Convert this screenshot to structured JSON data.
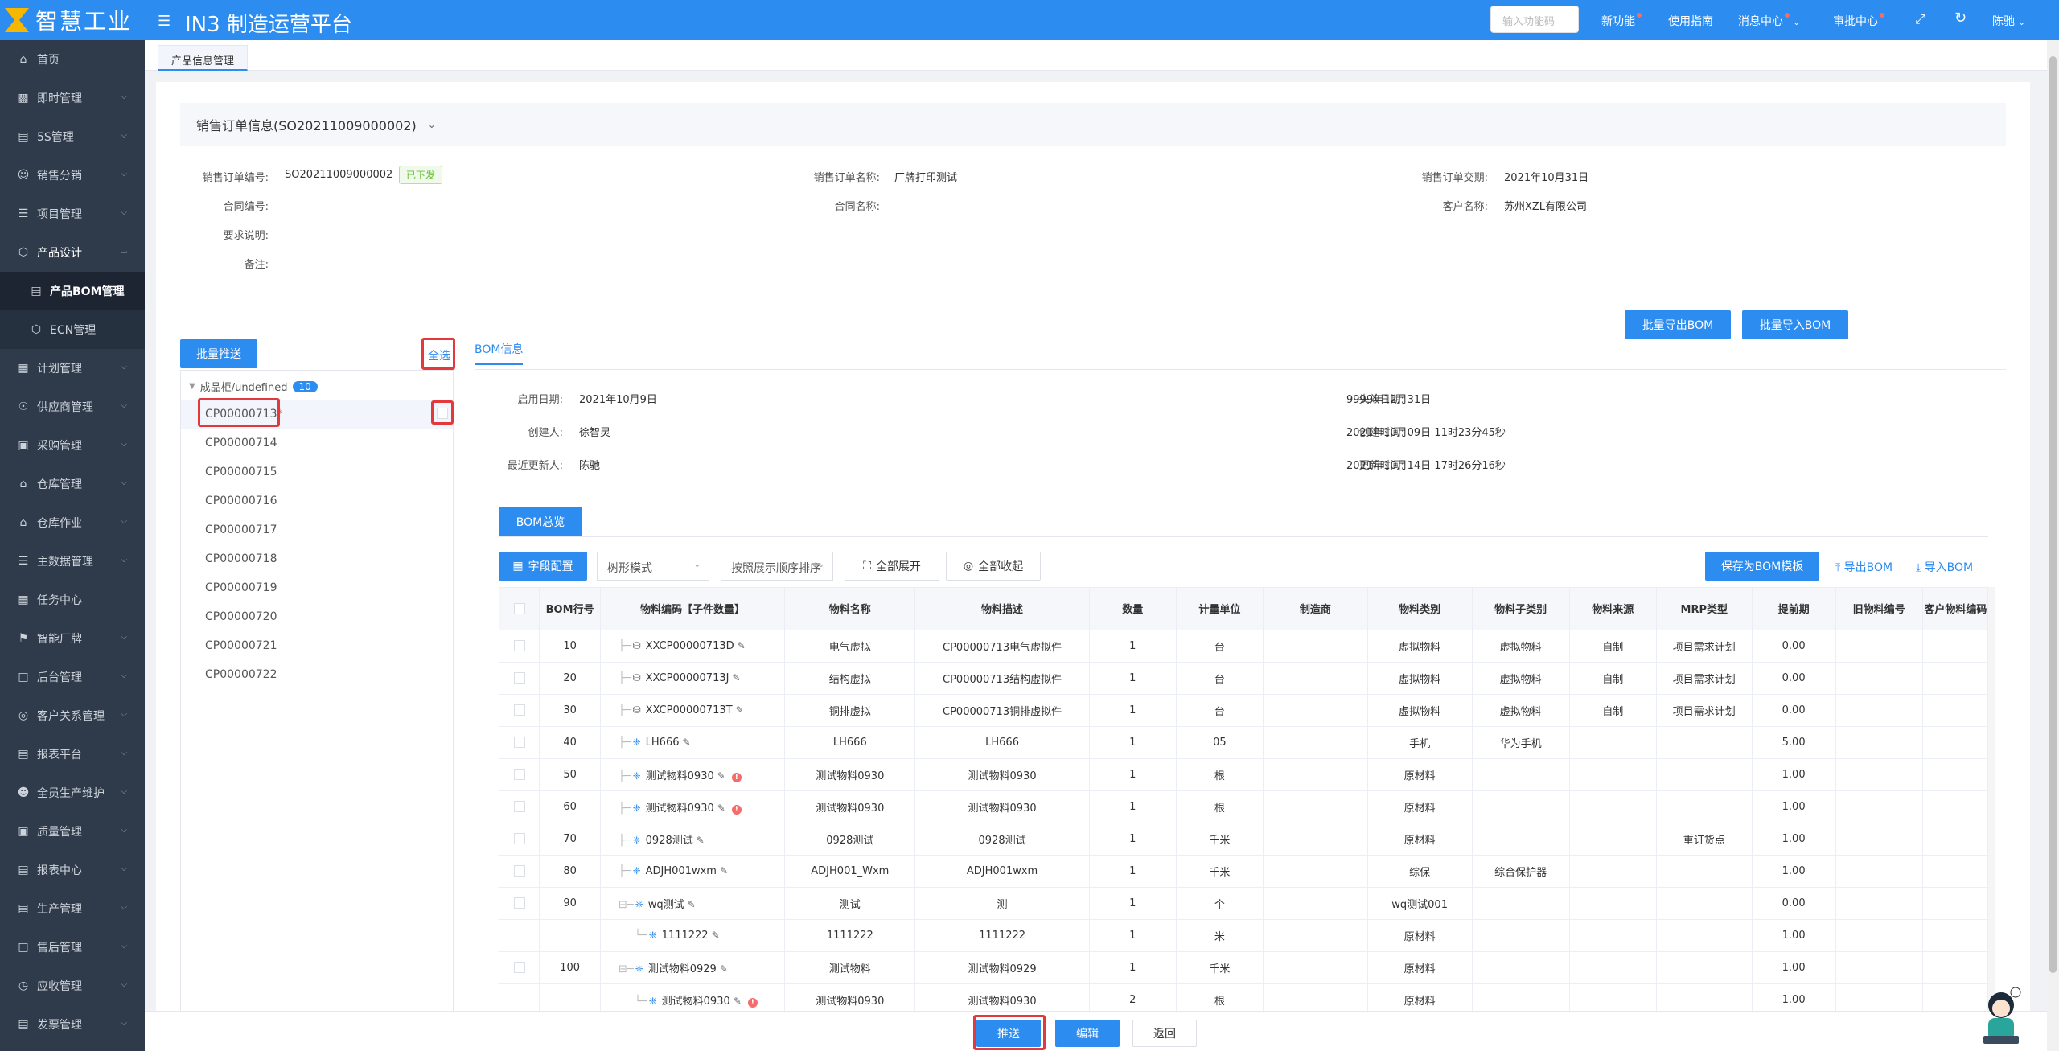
{
  "brand": {
    "logo_text": "智慧工业",
    "app_title": "IN3 制造运营平台"
  },
  "topbar": {
    "search_placeholder": "输入功能码",
    "items": [
      {
        "label": "新功能",
        "dot": true
      },
      {
        "label": "使用指南",
        "dot": false
      },
      {
        "label": "消息中心",
        "dot": true
      },
      {
        "label": "审批中心",
        "dot": true
      }
    ],
    "user": "陈驰"
  },
  "sidebar": {
    "items": [
      {
        "label": "首页",
        "icon": "home-icon"
      },
      {
        "label": "即时管理",
        "icon": "chart-icon"
      },
      {
        "label": "5S管理",
        "icon": "doc-icon"
      },
      {
        "label": "销售分销",
        "icon": "user-icon"
      },
      {
        "label": "项目管理",
        "icon": "list-icon"
      },
      {
        "label": "产品设计",
        "icon": "cube-icon"
      },
      {
        "label": "产品BOM管理",
        "icon": "doc-icon"
      },
      {
        "label": "ECN管理",
        "icon": "cube-icon"
      },
      {
        "label": "计划管理",
        "icon": "calendar-icon"
      },
      {
        "label": "供应商管理",
        "icon": "coin-icon"
      },
      {
        "label": "采购管理",
        "icon": "cart-icon"
      },
      {
        "label": "仓库管理",
        "icon": "warehouse-icon"
      },
      {
        "label": "仓库作业",
        "icon": "house-icon"
      },
      {
        "label": "主数据管理",
        "icon": "database-icon"
      },
      {
        "label": "任务中心",
        "icon": "calendar-icon"
      },
      {
        "label": "智能厂牌",
        "icon": "tag-icon"
      },
      {
        "label": "后台管理",
        "icon": "monitor-icon"
      },
      {
        "label": "客户关系管理",
        "icon": "target-icon"
      },
      {
        "label": "报表平台",
        "icon": "report-icon"
      },
      {
        "label": "全员生产维护",
        "icon": "users-icon"
      },
      {
        "label": "质量管理",
        "icon": "quality-icon"
      },
      {
        "label": "报表中心",
        "icon": "report-icon"
      },
      {
        "label": "生产管理",
        "icon": "doc-icon"
      },
      {
        "label": "售后管理",
        "icon": "monitor-icon"
      },
      {
        "label": "应收管理",
        "icon": "clock-icon"
      },
      {
        "label": "发票管理",
        "icon": "invoice-icon"
      }
    ]
  },
  "tabs": {
    "current": "产品信息管理"
  },
  "order": {
    "section_title": "销售订单信息(SO20211009000002)",
    "fields": {
      "order_no_label": "销售订单编号:",
      "order_no": "SO20211009000002",
      "status": "已下发",
      "order_name_label": "销售订单名称:",
      "order_name": "厂牌打印测试",
      "due_label": "销售订单交期:",
      "due": "2021年10月31日",
      "contract_no_label": "合同编号:",
      "contract_name_label": "合同名称:",
      "customer_label": "客户名称:",
      "customer": "苏州XZL有限公司",
      "req_label": "要求说明:",
      "remark_label": "备注:"
    }
  },
  "actions": {
    "batch_export": "批量导出BOM",
    "batch_import": "批量导入BOM"
  },
  "left": {
    "batch_push": "批量推送",
    "select_all": "全选",
    "root": {
      "label": "成品柜/undefined",
      "count": "10"
    },
    "products": [
      "CP00000713",
      "CP00000714",
      "CP00000715",
      "CP00000716",
      "CP00000717",
      "CP00000718",
      "CP00000719",
      "CP00000720",
      "CP00000721",
      "CP00000722"
    ],
    "required_mark": "*"
  },
  "bom_info": {
    "tab": "BOM信息",
    "start_label": "启用日期:",
    "start": "2021年10月9日",
    "end_label": "失效日期:",
    "end": "9999年12月31日",
    "creator_label": "创建人:",
    "creator": "徐智灵",
    "created_label": "创建时间:",
    "created": "2021年10月09日 11时23分45秒",
    "updater_label": "最近更新人:",
    "updater": "陈驰",
    "updated_label": "更新时间:",
    "updated": "2021年10月14日 17时26分16秒"
  },
  "bom_overview": {
    "tab": "BOM总览",
    "field_config": "字段配置",
    "mode": "树形模式",
    "sort": "按照展示顺序排序",
    "expand_all": "全部展开",
    "collapse_all": "全部收起",
    "save_template": "保存为BOM模板",
    "export": "导出BOM",
    "import": "导入BOM"
  },
  "table": {
    "headers": [
      "BOM行号",
      "物料编码【子件数量】",
      "物料名称",
      "物料描述",
      "数量",
      "计量单位",
      "制造商",
      "物料类别",
      "物料子类别",
      "物料来源",
      "MRP类型",
      "提前期",
      "旧物料编号",
      "客户物料编码"
    ],
    "rows": [
      {
        "line": "10",
        "code": "XXCP00000713D",
        "icon": "db",
        "level": 1,
        "name": "电气虚拟",
        "desc": "CP00000713电气虚拟件",
        "qty": "1",
        "unit": "台",
        "mfr": "",
        "cat": "虚拟物料",
        "subcat": "虚拟物料",
        "src": "自制",
        "mrp": "项目需求计划",
        "lead": "0.00",
        "warn": false,
        "check": true,
        "toggle": false
      },
      {
        "line": "20",
        "code": "XXCP00000713J",
        "icon": "db",
        "level": 1,
        "name": "结构虚拟",
        "desc": "CP00000713结构虚拟件",
        "qty": "1",
        "unit": "台",
        "mfr": "",
        "cat": "虚拟物料",
        "subcat": "虚拟物料",
        "src": "自制",
        "mrp": "项目需求计划",
        "lead": "0.00",
        "warn": false,
        "check": true,
        "toggle": false
      },
      {
        "line": "30",
        "code": "XXCP00000713T",
        "icon": "db",
        "level": 1,
        "name": "铜排虚拟",
        "desc": "CP00000713铜排虚拟件",
        "qty": "1",
        "unit": "台",
        "mfr": "",
        "cat": "虚拟物料",
        "subcat": "虚拟物料",
        "src": "自制",
        "mrp": "项目需求计划",
        "lead": "0.00",
        "warn": false,
        "check": true,
        "toggle": false
      },
      {
        "line": "40",
        "code": "LH666",
        "icon": "mat",
        "level": 1,
        "name": "LH666",
        "desc": "LH666",
        "qty": "1",
        "unit": "05",
        "mfr": "",
        "cat": "手机",
        "subcat": "华为手机",
        "src": "",
        "mrp": "",
        "lead": "5.00",
        "warn": false,
        "check": true,
        "toggle": false
      },
      {
        "line": "50",
        "code": "测试物料0930",
        "icon": "mat",
        "level": 1,
        "name": "测试物料0930",
        "desc": "测试物料0930",
        "qty": "1",
        "unit": "根",
        "mfr": "",
        "cat": "原材料",
        "subcat": "",
        "src": "",
        "mrp": "",
        "lead": "1.00",
        "warn": true,
        "check": true,
        "toggle": false
      },
      {
        "line": "60",
        "code": "测试物料0930",
        "icon": "mat",
        "level": 1,
        "name": "测试物料0930",
        "desc": "测试物料0930",
        "qty": "1",
        "unit": "根",
        "mfr": "",
        "cat": "原材料",
        "subcat": "",
        "src": "",
        "mrp": "",
        "lead": "1.00",
        "warn": true,
        "check": true,
        "toggle": false
      },
      {
        "line": "70",
        "code": "0928测试",
        "icon": "mat",
        "level": 1,
        "name": "0928测试",
        "desc": "0928测试",
        "qty": "1",
        "unit": "千米",
        "mfr": "",
        "cat": "原材料",
        "subcat": "",
        "src": "",
        "mrp": "重订货点",
        "lead": "1.00",
        "warn": false,
        "check": true,
        "toggle": false
      },
      {
        "line": "80",
        "code": "ADJH001wxm",
        "icon": "mat",
        "level": 1,
        "name": "ADJH001_Wxm",
        "desc": "ADJH001wxm",
        "qty": "1",
        "unit": "千米",
        "mfr": "",
        "cat": "综保",
        "subcat": "综合保护器",
        "src": "",
        "mrp": "",
        "lead": "1.00",
        "warn": false,
        "check": true,
        "toggle": false
      },
      {
        "line": "90",
        "code": "wq测试",
        "icon": "mat",
        "level": 1,
        "name": "测试",
        "desc": "测",
        "qty": "1",
        "unit": "个",
        "mfr": "",
        "cat": "wq测试001",
        "subcat": "",
        "src": "",
        "mrp": "",
        "lead": "0.00",
        "warn": false,
        "check": true,
        "toggle": true
      },
      {
        "line": "",
        "code": "1111222",
        "icon": "mat",
        "level": 2,
        "name": "1111222",
        "desc": "1111222",
        "qty": "1",
        "unit": "米",
        "mfr": "",
        "cat": "原材料",
        "subcat": "",
        "src": "",
        "mrp": "",
        "lead": "1.00",
        "warn": false,
        "check": false,
        "toggle": false
      },
      {
        "line": "100",
        "code": "测试物料0929",
        "icon": "mat",
        "level": 1,
        "name": "测试物料",
        "desc": "测试物料0929",
        "qty": "1",
        "unit": "千米",
        "mfr": "",
        "cat": "原材料",
        "subcat": "",
        "src": "",
        "mrp": "",
        "lead": "1.00",
        "warn": false,
        "check": true,
        "toggle": true
      },
      {
        "line": "",
        "code": "测试物料0930",
        "icon": "mat",
        "level": 2,
        "name": "测试物料0930",
        "desc": "测试物料0930",
        "qty": "2",
        "unit": "根",
        "mfr": "",
        "cat": "原材料",
        "subcat": "",
        "src": "",
        "mrp": "",
        "lead": "1.00",
        "warn": true,
        "check": false,
        "toggle": false
      }
    ]
  },
  "footer": {
    "push": "推送",
    "edit": "编辑",
    "back": "返回"
  },
  "colors": {
    "primary": "#2d8cf0",
    "sidebar": "#2f3a4a",
    "highlight": "#e4393c",
    "success": "#67c23a",
    "danger": "#f56c6c"
  }
}
